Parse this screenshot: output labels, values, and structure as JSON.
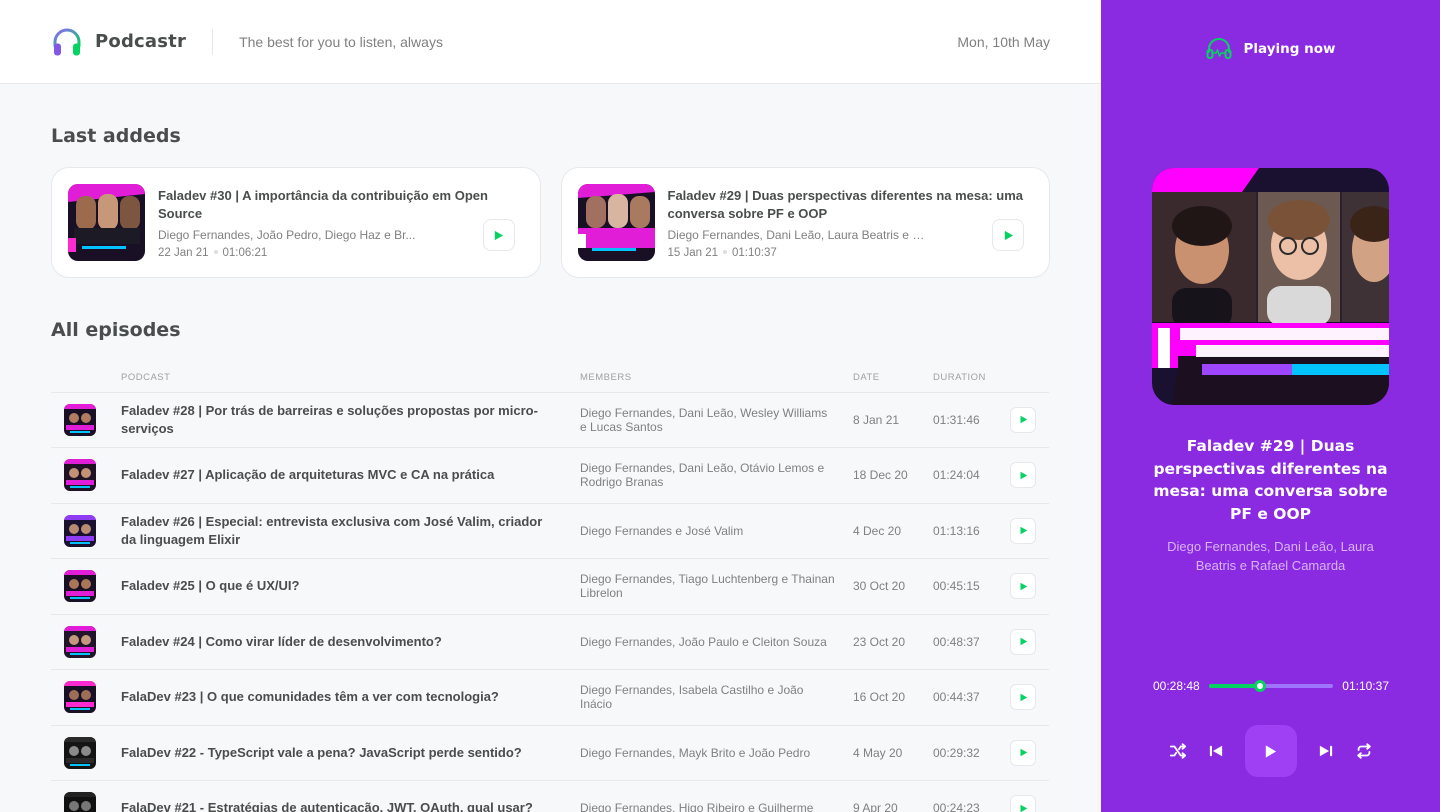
{
  "app": {
    "name": "Podcastr",
    "tagline": "The best for you to listen, always",
    "date": "Mon, 10th May",
    "colors": {
      "accent": "#8a2be2",
      "green": "#04d361",
      "text": "#494d4b",
      "muted": "#808080"
    }
  },
  "latest": {
    "title": "Last addeds",
    "episodes": [
      {
        "title": "Faladev #30 | A importância da contribuição em Open Source",
        "members": "Diego Fernandes, João Pedro, Diego Haz e Br...",
        "date": "22 Jan 21",
        "duration": "01:06:21",
        "icon": "play-icon"
      },
      {
        "title": "Faladev #29 | Duas perspectivas diferentes na mesa: uma conversa sobre PF e OOP",
        "members": "Diego Fernandes, Dani Leão, Laura Beatris e R...",
        "date": "15 Jan 21",
        "duration": "01:10:37",
        "icon": "play-icon"
      }
    ]
  },
  "all_episodes": {
    "title": "All episodes",
    "columns": [
      "Podcast",
      "Members",
      "Date",
      "Duration"
    ],
    "rows": [
      {
        "title": "Faladev #28 | Por trás de barreiras e soluções propostas por micro-serviços",
        "members": "Diego Fernandes, Dani Leão, Wesley Williams e Lucas Santos",
        "date": "8 Jan 21",
        "duration": "01:31:46"
      },
      {
        "title": "Faladev #27 | Aplicação de arquiteturas MVC e CA na prática",
        "members": "Diego Fernandes, Dani Leão, Otávio Lemos e Rodrigo Branas",
        "date": "18 Dec 20",
        "duration": "01:24:04"
      },
      {
        "title": "Faladev #26 | Especial: entrevista exclusiva com José Valim, criador da linguagem Elixir",
        "members": "Diego Fernandes e José Valim",
        "date": "4 Dec 20",
        "duration": "01:13:16"
      },
      {
        "title": "Faladev #25 | O que é UX/UI?",
        "members": "Diego Fernandes, Tiago Luchtenberg e Thainan Librelon",
        "date": "30 Oct 20",
        "duration": "00:45:15"
      },
      {
        "title": "Faladev #24 | Como virar líder de desenvolvimento?",
        "members": "Diego Fernandes, João Paulo e Cleiton Souza",
        "date": "23 Oct 20",
        "duration": "00:48:37"
      },
      {
        "title": "FalaDev #23 | O que comunidades têm a ver com tecnologia?",
        "members": "Diego Fernandes, Isabela Castilho e João Inácio",
        "date": "16 Oct 20",
        "duration": "00:44:37"
      },
      {
        "title": "FalaDev #22 - TypeScript vale a pena? JavaScript perde sentido?",
        "members": "Diego Fernandes, Mayk Brito e João Pedro",
        "date": "4 May 20",
        "duration": "00:29:32"
      },
      {
        "title": "FalaDev #21 - Estratégias de autenticação, JWT, OAuth, qual usar?",
        "members": "Diego Fernandes, Higo Ribeiro e Guilherme",
        "date": "9 Apr 20",
        "duration": "00:24:23"
      }
    ]
  },
  "player": {
    "heading": "Playing now",
    "title": "Faladev #29 | Duas perspectivas diferentes na mesa: uma conversa sobre PF e OOP",
    "members": "Diego Fernandes, Dani Leão, Laura Beatris e Rafael Camarda",
    "current_time": "00:28:48",
    "total_time": "01:10:37",
    "progress": 0.408,
    "controls": [
      "shuffle-icon",
      "previous-icon",
      "play-icon",
      "next-icon",
      "repeat-icon"
    ]
  }
}
